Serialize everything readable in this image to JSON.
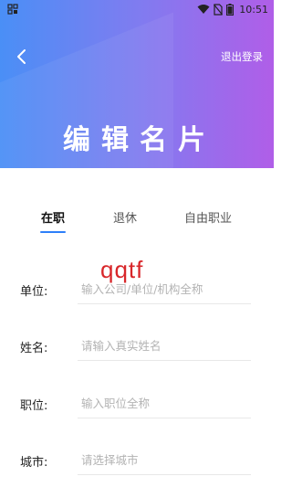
{
  "status_bar": {
    "time": "10:51",
    "battery_icon": "battery-icon",
    "wifi_icon": "wifi-icon",
    "sim_icon": "no-sim-icon",
    "app_icon": "grid-icon"
  },
  "header": {
    "back_icon": "chevron-left-icon",
    "logout_label": "退出登录",
    "title": "编辑名片",
    "gradient_start": "#4a8ff6",
    "gradient_end": "#b05ee8"
  },
  "tabs": [
    {
      "label": "在职",
      "active": true
    },
    {
      "label": "退休",
      "active": false
    },
    {
      "label": "自由职业",
      "active": false
    }
  ],
  "accent_color": "#2d7ff9",
  "form": {
    "rows": [
      {
        "label": "单位:",
        "placeholder": "输入公司/单位/机构全称",
        "value": ""
      },
      {
        "label": "姓名:",
        "placeholder": "请输入真实姓名",
        "value": ""
      },
      {
        "label": "职位:",
        "placeholder": "输入职位全称",
        "value": ""
      },
      {
        "label": "城市:",
        "placeholder": "请选择城市",
        "value": ""
      }
    ]
  },
  "watermark": {
    "text": "qqtf",
    "color": "#d8262a"
  }
}
